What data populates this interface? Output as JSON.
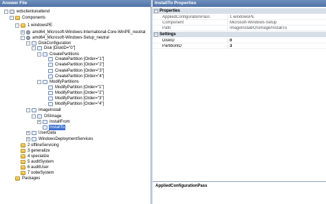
{
  "answer_file": {
    "title": "Answer File",
    "tree": [
      {
        "label": "wdsclientunattend",
        "icon": "gear-icon",
        "expander": "-"
      },
      {
        "label": "Components",
        "icon": "folder-icon",
        "expander": "-"
      },
      {
        "label": "1 windowsPE",
        "icon": "folder-icon",
        "expander": "-"
      },
      {
        "label": "amd64_Microsoft-Windows-International-Core-WinPE_neutral",
        "icon": "component-icon",
        "expander": "+"
      },
      {
        "label": "amd64_Microsoft-Windows-Setup_neutral",
        "icon": "component-icon",
        "expander": "-"
      },
      {
        "label": "DiskConfiguration",
        "icon": "item-icon",
        "expander": "-"
      },
      {
        "label": "Disk [DiskID=\"0\"]",
        "icon": "item-icon",
        "expander": "-"
      },
      {
        "label": "CreatePartitions",
        "icon": "item-icon",
        "expander": "-"
      },
      {
        "label": "CreatePartition [Order=\"1\"]",
        "icon": "item-icon",
        "expander": ""
      },
      {
        "label": "CreatePartition [Order=\"2\"]",
        "icon": "item-icon",
        "expander": ""
      },
      {
        "label": "CreatePartition [Order=\"3\"]",
        "icon": "item-icon",
        "expander": ""
      },
      {
        "label": "CreatePartition [Order=\"4\"]",
        "icon": "item-icon",
        "expander": ""
      },
      {
        "label": "ModifyPartitions",
        "icon": "item-icon",
        "expander": "-"
      },
      {
        "label": "ModifyPartition [Order=\"1\"]",
        "icon": "item-icon",
        "expander": ""
      },
      {
        "label": "ModifyPartition [Order=\"2\"]",
        "icon": "item-icon",
        "expander": ""
      },
      {
        "label": "ModifyPartition [Order=\"3\"]",
        "icon": "item-icon",
        "expander": ""
      },
      {
        "label": "ModifyPartition [Order=\"4\"]",
        "icon": "item-icon",
        "expander": ""
      },
      {
        "label": "ImageInstall",
        "icon": "item-icon",
        "expander": "-"
      },
      {
        "label": "OSImage",
        "icon": "item-icon",
        "expander": "-"
      },
      {
        "label": "InstallFrom",
        "icon": "item-icon",
        "expander": "+"
      },
      {
        "label": "InstallTo",
        "icon": "item-icon",
        "expander": "",
        "selected": true
      },
      {
        "label": "UserData",
        "icon": "item-icon",
        "expander": "+"
      },
      {
        "label": "WindowsDeploymentServices",
        "icon": "item-icon",
        "expander": "+"
      },
      {
        "label": "2 offlineServicing",
        "icon": "folder-icon",
        "expander": ""
      },
      {
        "label": "3 generalize",
        "icon": "folder-icon",
        "expander": ""
      },
      {
        "label": "4 specialize",
        "icon": "folder-icon",
        "expander": ""
      },
      {
        "label": "5 auditSystem",
        "icon": "folder-icon",
        "expander": ""
      },
      {
        "label": "6 auditUser",
        "icon": "folder-icon",
        "expander": ""
      },
      {
        "label": "7 oobeSystem",
        "icon": "folder-icon",
        "expander": ""
      },
      {
        "label": "Packages",
        "icon": "folder-icon",
        "expander": ""
      }
    ]
  },
  "properties": {
    "title": "InstallTo Properties",
    "sections": {
      "properties": {
        "label": "Properties",
        "rows": [
          {
            "name": "AppliedConfigurationPass",
            "value": "1 windowsPE"
          },
          {
            "name": "Component",
            "value": "Microsoft-Windows-Setup"
          },
          {
            "name": "Path",
            "value": "ImageInstall/OSImage/InstallTo"
          }
        ]
      },
      "settings": {
        "label": "Settings",
        "rows": [
          {
            "name": "DiskID",
            "value": "0"
          },
          {
            "name": "PartitionID",
            "value": "3"
          }
        ]
      }
    },
    "description_title": "AppliedConfigurationPass"
  }
}
